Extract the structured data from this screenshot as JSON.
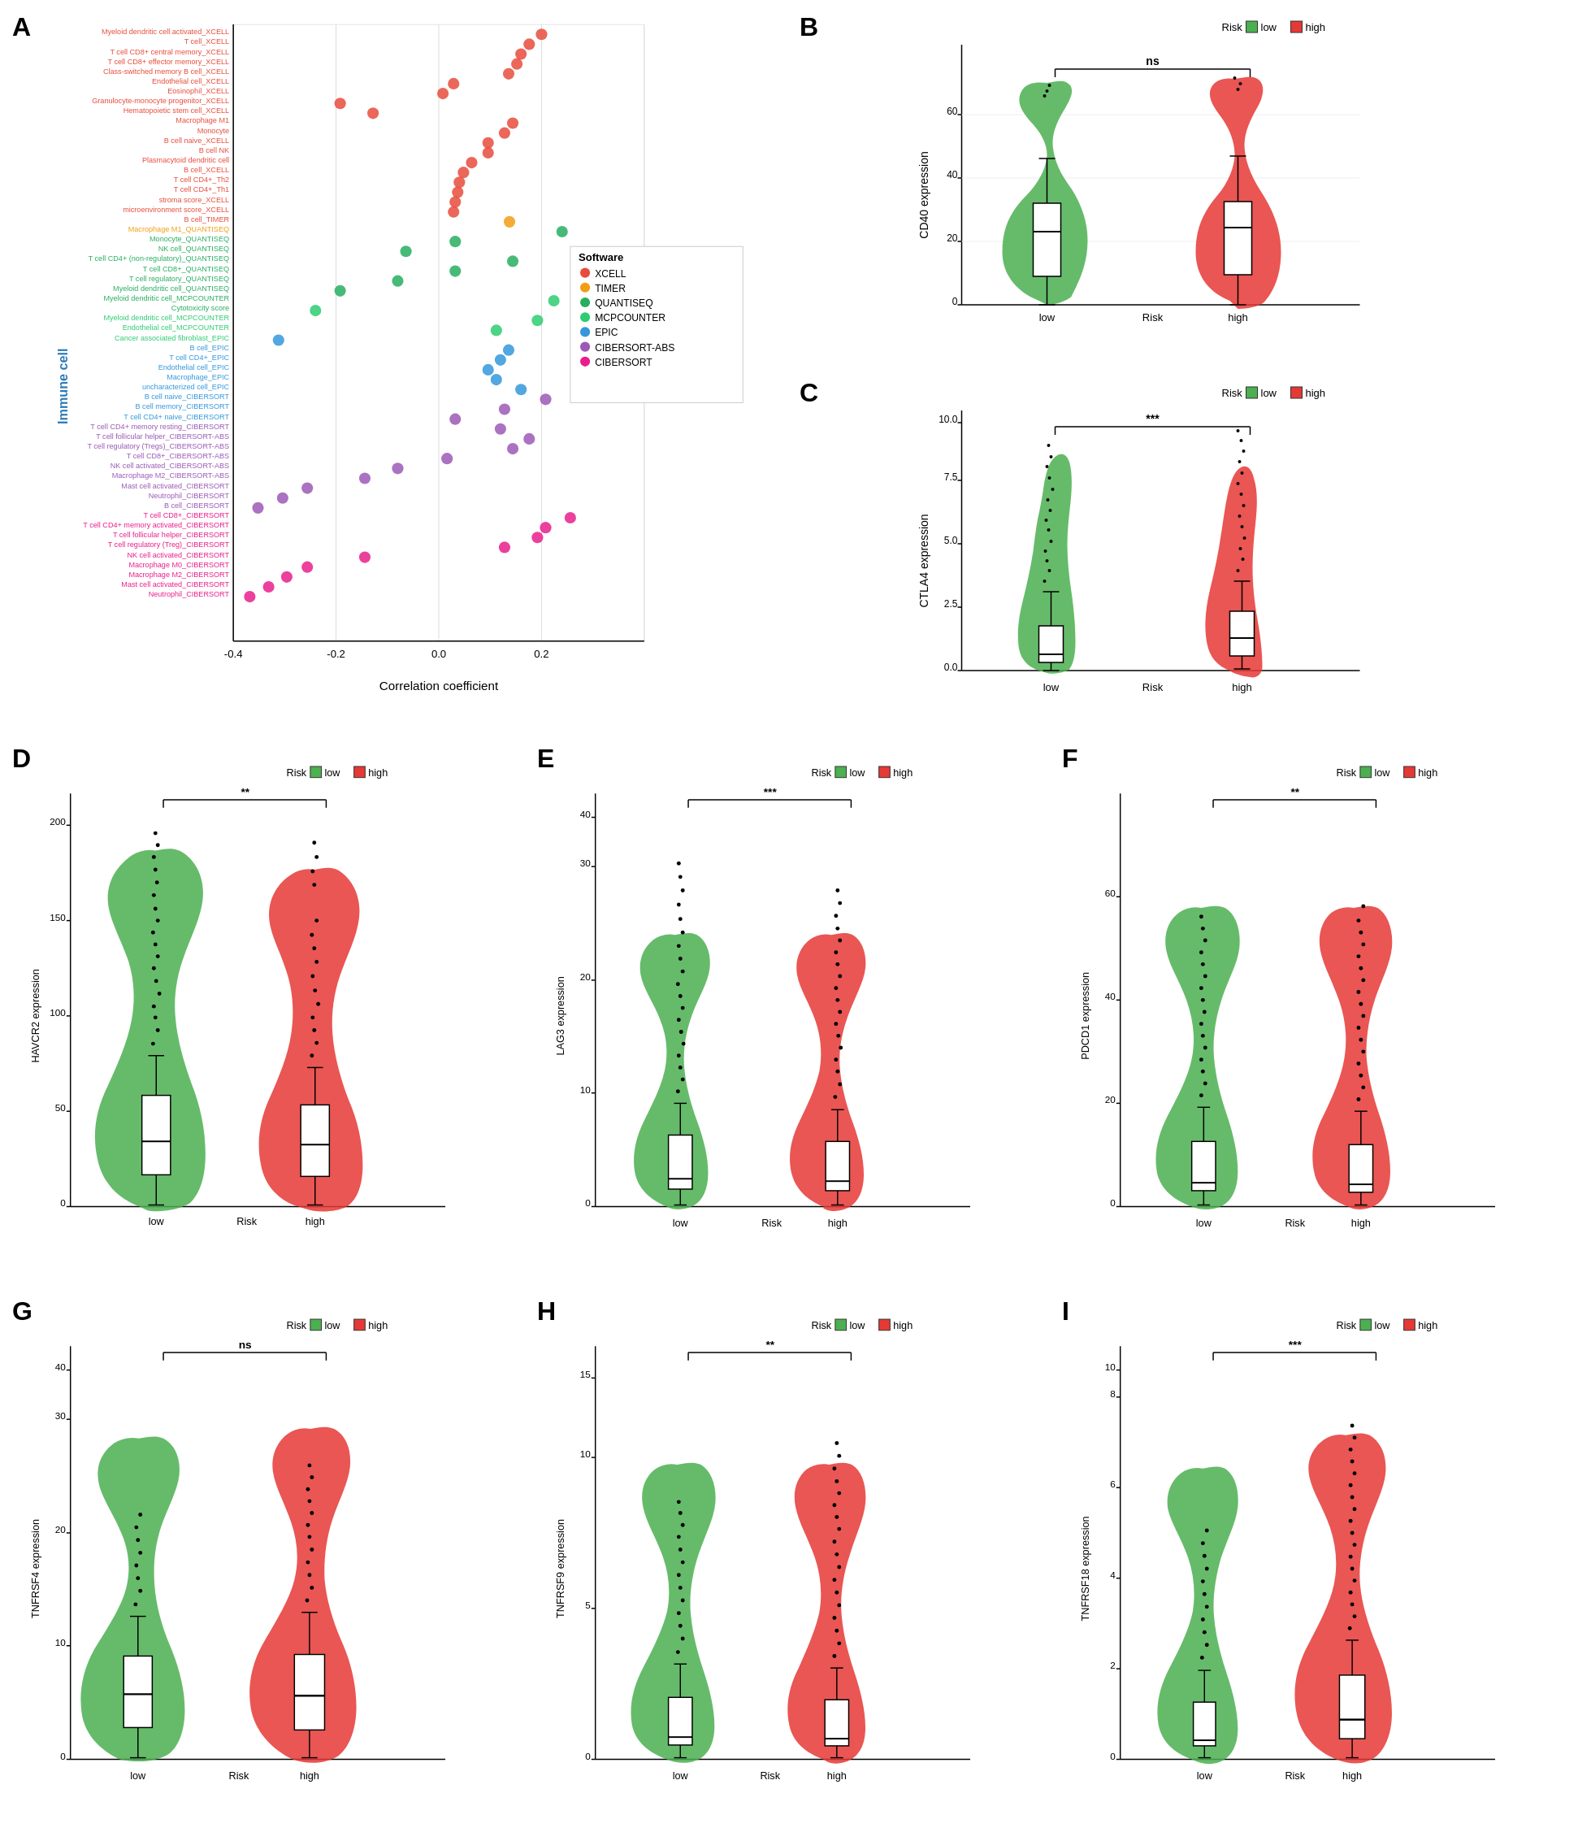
{
  "panels": {
    "A": {
      "label": "A",
      "title": "Immune cell",
      "x_axis_label": "Correlation coefficient",
      "x_ticks": [
        "-0.4",
        "-0.2",
        "0.0",
        "0.2"
      ],
      "legend": {
        "title": "Software",
        "items": [
          {
            "name": "XCELL",
            "color": "#E74C3C"
          },
          {
            "name": "TIMER",
            "color": "#F39C12"
          },
          {
            "name": "QUANTISEQ",
            "color": "#27AE60"
          },
          {
            "name": "MCPCOUNTER",
            "color": "#2ECC71"
          },
          {
            "name": "EPIC",
            "color": "#3498DB"
          },
          {
            "name": "CIBERSORT-ABS",
            "color": "#9B59B6"
          },
          {
            "name": "CIBERSORT",
            "color": "#E91E8C"
          }
        ]
      }
    },
    "B": {
      "label": "B",
      "gene": "CD40",
      "y_axis_label": "CD40 expression",
      "x_axis_label": "Risk",
      "significance": "ns",
      "y_max": 60,
      "y_ticks": [
        "0",
        "20",
        "40",
        "60"
      ],
      "groups": [
        "low",
        "high"
      ],
      "colors": [
        "#4CAF50",
        "#E53935"
      ]
    },
    "C": {
      "label": "C",
      "gene": "CTLA4",
      "y_axis_label": "CTLA4 expression",
      "x_axis_label": "Risk",
      "significance": "***",
      "y_max": 10,
      "y_ticks": [
        "0.0",
        "2.5",
        "5.0",
        "7.5",
        "10.0"
      ],
      "groups": [
        "low",
        "high"
      ],
      "colors": [
        "#4CAF50",
        "#E53935"
      ]
    },
    "D": {
      "label": "D",
      "gene": "HAVCR2",
      "y_axis_label": "HAVCR2 expression",
      "x_axis_label": "Risk",
      "significance": "**",
      "y_max": 200,
      "y_ticks": [
        "0",
        "50",
        "100",
        "150",
        "200"
      ],
      "groups": [
        "low",
        "high"
      ],
      "colors": [
        "#4CAF50",
        "#E53935"
      ]
    },
    "E": {
      "label": "E",
      "gene": "LAG3",
      "y_axis_label": "LAG3 expression",
      "x_axis_label": "Risk",
      "significance": "***",
      "y_max": 40,
      "y_ticks": [
        "0",
        "10",
        "20",
        "30",
        "40"
      ],
      "groups": [
        "low",
        "high"
      ],
      "colors": [
        "#4CAF50",
        "#E53935"
      ]
    },
    "F": {
      "label": "F",
      "gene": "PDCD1",
      "y_axis_label": "PDCD1 expression",
      "x_axis_label": "Risk",
      "significance": "**",
      "y_max": 60,
      "y_ticks": [
        "0",
        "20",
        "40",
        "60"
      ],
      "groups": [
        "low",
        "high"
      ],
      "colors": [
        "#4CAF50",
        "#E53935"
      ]
    },
    "G": {
      "label": "G",
      "gene": "TNFRSF4",
      "y_axis_label": "TNFRSF4 expression",
      "x_axis_label": "Risk",
      "significance": "ns",
      "y_max": 40,
      "y_ticks": [
        "0",
        "10",
        "20",
        "30",
        "40"
      ],
      "groups": [
        "low",
        "high"
      ],
      "colors": [
        "#4CAF50",
        "#E53935"
      ]
    },
    "H": {
      "label": "H",
      "gene": "TNFRSF9",
      "y_axis_label": "TNFRSF9 expression",
      "x_axis_label": "Risk",
      "significance": "**",
      "y_max": 15,
      "y_ticks": [
        "0",
        "5",
        "10",
        "15"
      ],
      "groups": [
        "low",
        "high"
      ],
      "colors": [
        "#4CAF50",
        "#E53935"
      ]
    },
    "I": {
      "label": "I",
      "gene": "TNFRSF18",
      "y_axis_label": "TNFRSF18 expression",
      "x_axis_label": "Risk",
      "significance": "***",
      "y_max": 10,
      "y_ticks": [
        "0",
        "2",
        "4",
        "6",
        "8",
        "10"
      ],
      "groups": [
        "low",
        "high"
      ],
      "colors": [
        "#4CAF50",
        "#E53935"
      ]
    }
  },
  "risk_legend": {
    "label": "Risk",
    "items": [
      {
        "name": "low",
        "color": "#4CAF50"
      },
      {
        "name": "high",
        "color": "#E53935"
      }
    ]
  }
}
